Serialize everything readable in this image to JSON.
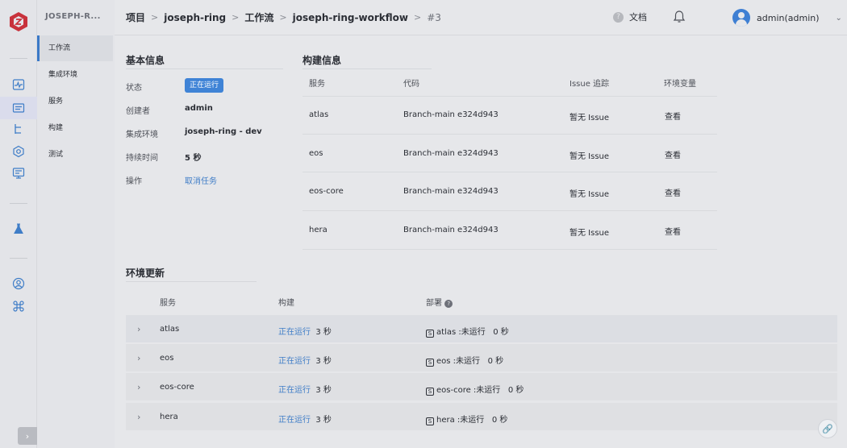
{
  "sidebar": {
    "project_title": "JOSEPH-R...",
    "items": [
      {
        "label": "工作流"
      },
      {
        "label": "集成环境"
      },
      {
        "label": "服务"
      },
      {
        "label": "构建"
      },
      {
        "label": "测试"
      }
    ]
  },
  "rail": {
    "icons": [
      "logo-icon",
      "pulse-icon",
      "project-icon",
      "tree-icon",
      "settings-hex-icon",
      "monitor-icon",
      "flask-icon",
      "user-circle-icon",
      "command-icon"
    ],
    "expand_label": "›"
  },
  "header": {
    "breadcrumb": [
      "项目",
      "joseph-ring",
      "工作流",
      "joseph-ring-workflow",
      "#3"
    ],
    "separator": ">",
    "docs_label": "文档",
    "user_name": "admin(admin)"
  },
  "basic_info": {
    "title": "基本信息",
    "status_label": "状态",
    "status_value": "正在运行",
    "creator_label": "创建者",
    "creator_value": "admin",
    "env_label": "集成环境",
    "env_value": "joseph-ring - dev",
    "duration_label": "持续时间",
    "duration_value": "5 秒",
    "action_label": "操作",
    "action_value": "取消任务"
  },
  "build_info": {
    "title": "构建信息",
    "headers": [
      "服务",
      "代码",
      "Issue 追踪",
      "环境变量"
    ],
    "rows": [
      {
        "service": "atlas",
        "code": "Branch-main e324d943",
        "issue": "暂无 Issue",
        "env": "查看"
      },
      {
        "service": "eos",
        "code": "Branch-main e324d943",
        "issue": "暂无 Issue",
        "env": "查看"
      },
      {
        "service": "eos-core",
        "code": "Branch-main e324d943",
        "issue": "暂无 Issue",
        "env": "查看"
      },
      {
        "service": "hera",
        "code": "Branch-main e324d943",
        "issue": "暂无 Issue",
        "env": "查看"
      }
    ]
  },
  "env_update": {
    "title": "环境更新",
    "headers": [
      "服务",
      "构建",
      "部署"
    ],
    "rows": [
      {
        "service": "atlas",
        "build_status": "正在运行",
        "build_time": "3 秒",
        "deploy": "atlas :未运行",
        "deploy_time": "0 秒"
      },
      {
        "service": "eos",
        "build_status": "正在运行",
        "build_time": "3 秒",
        "deploy": "eos :未运行",
        "deploy_time": "0 秒"
      },
      {
        "service": "eos-core",
        "build_status": "正在运行",
        "build_time": "3 秒",
        "deploy": "eos-core :未运行",
        "deploy_time": "0 秒"
      },
      {
        "service": "hera",
        "build_status": "正在运行",
        "build_time": "3 秒",
        "deploy": "hera :未运行",
        "deploy_time": "0 秒"
      }
    ]
  },
  "colors": {
    "accent": "#3f83d6",
    "link": "#3f7dc7",
    "logo": "#c8323c"
  }
}
